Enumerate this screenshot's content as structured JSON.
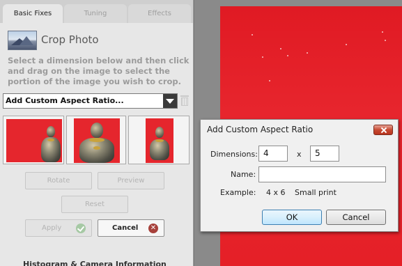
{
  "tabs": [
    {
      "label": "Basic Fixes"
    },
    {
      "label": "Tuning"
    },
    {
      "label": "Effects"
    }
  ],
  "crop": {
    "title": "Crop Photo",
    "instructions": "Select a dimension below and then click and drag on the image to select the portion of the image you wish to crop.",
    "aspect_select_value": "Add Custom Aspect Ratio..."
  },
  "buttons": {
    "rotate": "Rotate",
    "preview": "Preview",
    "reset": "Reset",
    "apply": "Apply",
    "cancel": "Cancel"
  },
  "histogram_label": "Histogram & Camera Information",
  "dialog": {
    "title": "Add Custom Aspect Ratio",
    "dimensions_label": "Dimensions:",
    "width_value": "4",
    "times_label": "x",
    "height_value": "5",
    "name_label": "Name:",
    "name_value": "",
    "example_label": "Example:",
    "example_value": "4 x 6",
    "example_desc": "Small print",
    "ok": "OK",
    "cancel": "Cancel"
  },
  "colors": {
    "photo_red": "#e3222a",
    "panel_bg": "#e7e7e7"
  }
}
